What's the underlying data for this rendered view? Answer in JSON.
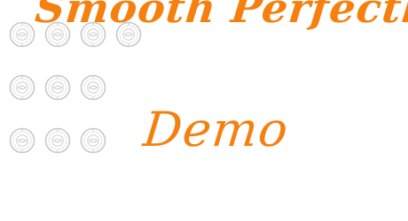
{
  "font_preview": {
    "title_text": "Smooth Perfectly",
    "demo_text": "Demo",
    "text_color": "#f5800f",
    "watermark_color": "#c8c8c8",
    "watermark_icon": "stamp-seal-icon",
    "watermark_rows": [
      4,
      3,
      3
    ]
  }
}
